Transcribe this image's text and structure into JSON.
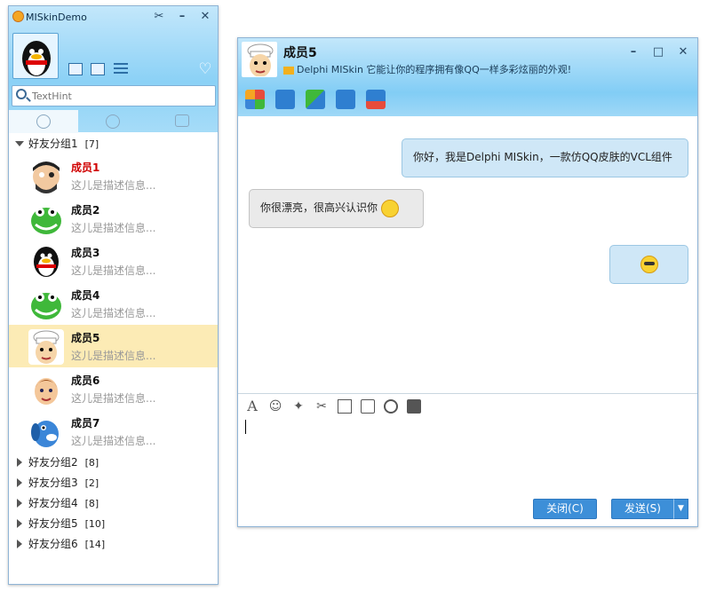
{
  "main_window": {
    "title": "MISkinDemo",
    "search_placeholder": "TextHint",
    "groups": [
      {
        "name": "好友分组1",
        "count": "[7]",
        "expanded": true
      },
      {
        "name": "好友分组2",
        "count": "[8]",
        "expanded": false
      },
      {
        "name": "好友分组3",
        "count": "[2]",
        "expanded": false
      },
      {
        "name": "好友分组4",
        "count": "[8]",
        "expanded": false
      },
      {
        "name": "好友分组5",
        "count": "[10]",
        "expanded": false
      },
      {
        "name": "好友分组6",
        "count": "[14]",
        "expanded": false
      }
    ],
    "members": [
      {
        "name": "成员1",
        "desc": "这儿是描述信息...",
        "color": "#d00000",
        "avatar": "pirate-avatar"
      },
      {
        "name": "成员2",
        "desc": "这儿是描述信息...",
        "avatar": "green-dino-avatar"
      },
      {
        "name": "成员3",
        "desc": "这儿是描述信息...",
        "avatar": "penguin-avatar"
      },
      {
        "name": "成员4",
        "desc": "这儿是描述信息...",
        "avatar": "green-dino-avatar"
      },
      {
        "name": "成员5",
        "desc": "这儿是描述信息...",
        "avatar": "chef-avatar",
        "selected": true
      },
      {
        "name": "成员6",
        "desc": "这儿是描述信息...",
        "avatar": "boy-avatar"
      },
      {
        "name": "成员7",
        "desc": "这儿是描述信息...",
        "avatar": "blue-dog-avatar"
      }
    ]
  },
  "chat_window": {
    "contact_name": "成员5",
    "signature": "Delphi MISkin 它能让你的程序拥有像QQ一样多彩炫丽的外观!",
    "messages": [
      {
        "from": "me",
        "text": "你好，我是Delphi MISkin，一款仿QQ皮肤的VCL组件"
      },
      {
        "from": "other",
        "text": "你很漂亮，很高兴认识你",
        "emoji": "smile-emoji"
      },
      {
        "from": "me",
        "text": "",
        "emoji": "cool-emoji"
      }
    ],
    "close_label": "关闭(C)",
    "send_label": "发送(S)"
  },
  "colors": {
    "accent": "#3d8fd8",
    "selection": "#fcebb5",
    "header": "#8bd1f6",
    "member1_name": "#d00000"
  }
}
